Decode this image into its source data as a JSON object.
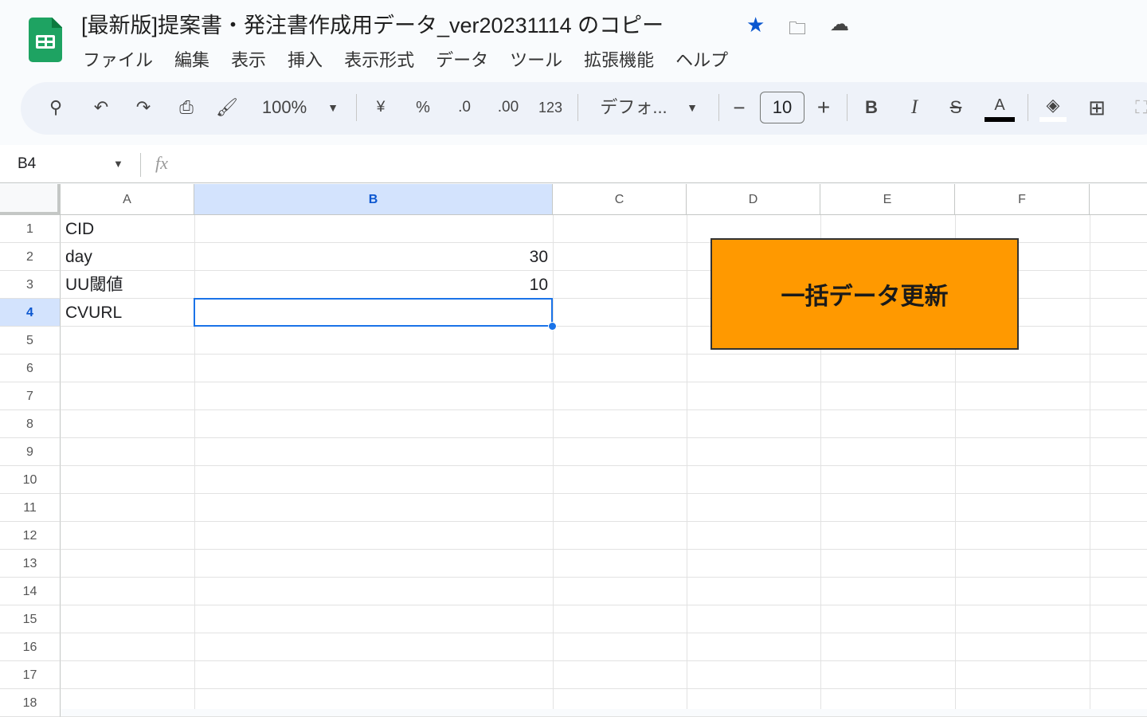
{
  "app": {
    "title": "[最新版]提案書・発注書作成用データ_ver20231114 のコピー",
    "star_color": "#0b57d0"
  },
  "menu": [
    "ファイル",
    "編集",
    "表示",
    "挿入",
    "表示形式",
    "データ",
    "ツール",
    "拡張機能",
    "ヘルプ"
  ],
  "toolbar": {
    "zoom": "100%",
    "currency": "¥",
    "percent": "%",
    "dec_decrease": ".0",
    "dec_increase": ".00",
    "number_format": "123",
    "font": "デフォ...",
    "font_size": "10",
    "minus": "−",
    "plus": "+",
    "bold": "B",
    "italic": "I",
    "text_color": "A"
  },
  "formula_bar": {
    "name_box": "B4",
    "fx": "fx",
    "value": ""
  },
  "columns": [
    "A",
    "B",
    "C",
    "D",
    "E",
    "F"
  ],
  "rows": [
    "1",
    "2",
    "3",
    "4",
    "5",
    "6",
    "7",
    "8",
    "9",
    "10",
    "11",
    "12",
    "13",
    "14",
    "15",
    "16",
    "17",
    "18"
  ],
  "cells": {
    "A1": "CID",
    "A2": "day",
    "B2": "30",
    "A3": "UU閾値",
    "B3": "10",
    "A4": "CVURL"
  },
  "drawing_button": {
    "label": "一括データ更新",
    "color": "#ff9900"
  }
}
